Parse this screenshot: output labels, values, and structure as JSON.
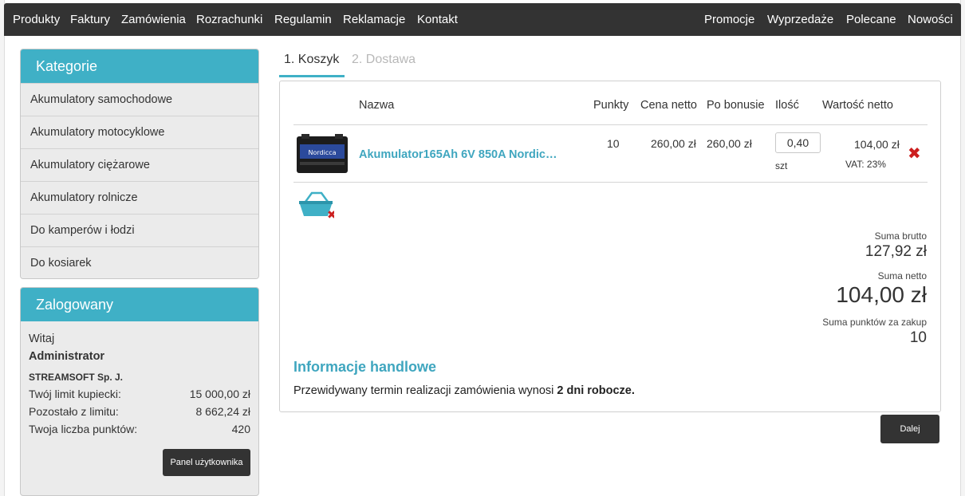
{
  "nav": {
    "left": [
      "Produkty",
      "Faktury",
      "Zamówienia",
      "Rozrachunki",
      "Regulamin",
      "Reklamacje",
      "Kontakt"
    ],
    "right": [
      "Promocje",
      "Wyprzedaże",
      "Polecane",
      "Nowości"
    ]
  },
  "categories": {
    "title": "Kategorie",
    "items": [
      "Akumulatory samochodowe",
      "Akumulatory motocyklowe",
      "Akumulatory ciężarowe",
      "Akumulatory rolnicze",
      "Do kamperów i łodzi",
      "Do kosiarek"
    ]
  },
  "login": {
    "title": "Zalogowany",
    "greeting": "Witaj",
    "user": "Administrator",
    "company": "STREAMSOFT Sp. J.",
    "rows": [
      {
        "label": "Twój limit kupiecki:",
        "value": "15 000,00 zł"
      },
      {
        "label": "Pozostało z limitu:",
        "value": "8 662,24 zł"
      },
      {
        "label": "Twoja liczba punktów:",
        "value": "420"
      }
    ],
    "panel_button": "Panel użytkownika"
  },
  "tabs": {
    "cart": "1. Koszyk",
    "delivery": "2. Dostawa"
  },
  "cart": {
    "headers": {
      "name": "Nazwa",
      "points": "Punkty",
      "net_price": "Cena netto",
      "after_bonus": "Po bonusie",
      "qty": "Ilość",
      "net_value": "Wartość netto"
    },
    "item": {
      "name": "Akumulator165Ah 6V 850A Nordic…",
      "image_label": "Nordicca",
      "points": "10",
      "net_price": "260,00 zł",
      "after_bonus": "260,00 zł",
      "qty": "0,40",
      "unit": "szt",
      "net_value": "104,00 zł",
      "vat": "VAT: 23%"
    },
    "totals": {
      "gross_label": "Suma brutto",
      "gross": "127,92 zł",
      "net_label": "Suma netto",
      "net": "104,00 zł",
      "points_label": "Suma punktów za zakup",
      "points": "10"
    },
    "info": {
      "title": "Informacje handlowe",
      "text_prefix": "Przewidywany termin realizacji zamówienia wynosi ",
      "text_bold": "2 dni robocze."
    }
  },
  "next_button": "Dalej",
  "colors": {
    "accent": "#3fb0c6",
    "nav_bg": "#333333",
    "delete": "#cc1f1f"
  }
}
